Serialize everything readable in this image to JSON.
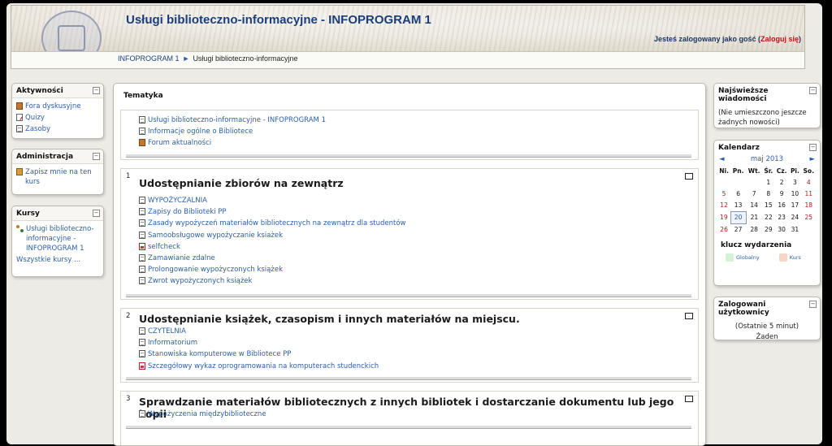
{
  "header": {
    "site_title": "Usługi biblioteczno-informacyjne - INFOPROGRAM 1",
    "login_prefix": "Jesteś zalogowany jako gość (",
    "login_link": "Zaloguj się",
    "login_suffix": ")"
  },
  "breadcrumb": {
    "home": "INFOPROGRAM 1",
    "separator": "►",
    "current": "Usługi biblioteczno-informacyjne"
  },
  "left": {
    "activities": {
      "title": "Aktywności",
      "items": [
        {
          "label": "Fora dyskusyjne",
          "icon": "forum-icon"
        },
        {
          "label": "Quizy",
          "icon": "quiz-icon"
        },
        {
          "label": "Zasoby",
          "icon": "resource-icon"
        }
      ]
    },
    "admin": {
      "title": "Administracja",
      "items": [
        {
          "label": "Zapisz mnie na ten kurs",
          "icon": "enrol-icon"
        }
      ]
    },
    "courses": {
      "title": "Kursy",
      "items": [
        {
          "label": "Usługi biblioteczno-informacyjne - INFOPROGRAM 1",
          "icon": "course-icon"
        }
      ],
      "all_label": "Wszystkie kursy ..."
    }
  },
  "center": {
    "title": "Tematyka",
    "intro": [
      {
        "label": "Usługi biblioteczno-informacyjne - INFOPROGRAM 1",
        "icon": "doc"
      },
      {
        "label": "Informacje ogólne o Bibliotece",
        "icon": "doc"
      },
      {
        "label": "Forum aktualności",
        "icon": "forum"
      }
    ],
    "sections": [
      {
        "number": "1",
        "title": "Udostępnianie zbiorów na zewnątrz",
        "items": [
          {
            "label": "WYPOŻYCZALNIA",
            "icon": "doc"
          },
          {
            "label": "Zapisy do Biblioteki PP",
            "icon": "doc"
          },
          {
            "label": "Zasady wypożyczeń materiałów bibliotecznych na zewnątrz dla studentów",
            "icon": "doc"
          },
          {
            "label": "Samoobsługowe wypożyczanie ksiażek",
            "icon": "doc"
          },
          {
            "label": "selfcheck",
            "icon": "pdf"
          },
          {
            "label": "Zamawianie zdalne",
            "icon": "doc"
          },
          {
            "label": "Prolongowanie wypożyczonych książek",
            "icon": "doc"
          },
          {
            "label": "Zwrot wypożyczonych książek",
            "icon": "doc"
          }
        ]
      },
      {
        "number": "2",
        "title": "Udostępnianie książek, czasopism i innych materiałów na miejscu.",
        "items": [
          {
            "label": "CZYTELNIA",
            "icon": "doc"
          },
          {
            "label": "Informatorium",
            "icon": "doc"
          },
          {
            "label": "Stanowiska komputerowe w Bibliotece PP",
            "icon": "doc"
          },
          {
            "label": "Szczegółowy wykaz oprogramowania na komputerach studenckich",
            "icon": "pdf"
          }
        ]
      },
      {
        "number": "3",
        "title": "Sprawdzanie materiałów bibliotecznych z innych bibliotek i dostarczanie dokumentu lub jego kopii",
        "items": [
          {
            "label": "Wypożyczenia międzybiblioteczne",
            "icon": "doc"
          }
        ]
      }
    ]
  },
  "right": {
    "news": {
      "title": "Najświeższe wiadomości",
      "text": "(Nie umieszczono jeszcze żadnych nowości)"
    },
    "calendar": {
      "title": "Kalendarz",
      "prev": "◄",
      "next": "►",
      "month": "maj 2013",
      "weekdays": [
        "Ni.",
        "Pn.",
        "Wt.",
        "Śr.",
        "Cz.",
        "Pi.",
        "So."
      ],
      "weeks": [
        [
          "",
          "",
          "",
          "1",
          "2",
          "3",
          "4"
        ],
        [
          "5",
          "6",
          "7",
          "8",
          "9",
          "10",
          "11"
        ],
        [
          "12",
          "13",
          "14",
          "15",
          "16",
          "17",
          "18"
        ],
        [
          "19",
          "20",
          "21",
          "22",
          "23",
          "24",
          "25"
        ],
        [
          "26",
          "27",
          "28",
          "29",
          "30",
          "31",
          ""
        ]
      ],
      "today": "20",
      "key_title": "klucz wydarzenia",
      "legend": [
        {
          "label": "Globalny",
          "color": "#d6f0d6"
        },
        {
          "label": "Kurs",
          "color": "#f7d6c8"
        }
      ]
    },
    "online": {
      "title": "Zalogowani użytkownicy",
      "period": "(Ostatnie 5 minut)",
      "none": "Żaden"
    }
  },
  "toggle_glyph": "−"
}
